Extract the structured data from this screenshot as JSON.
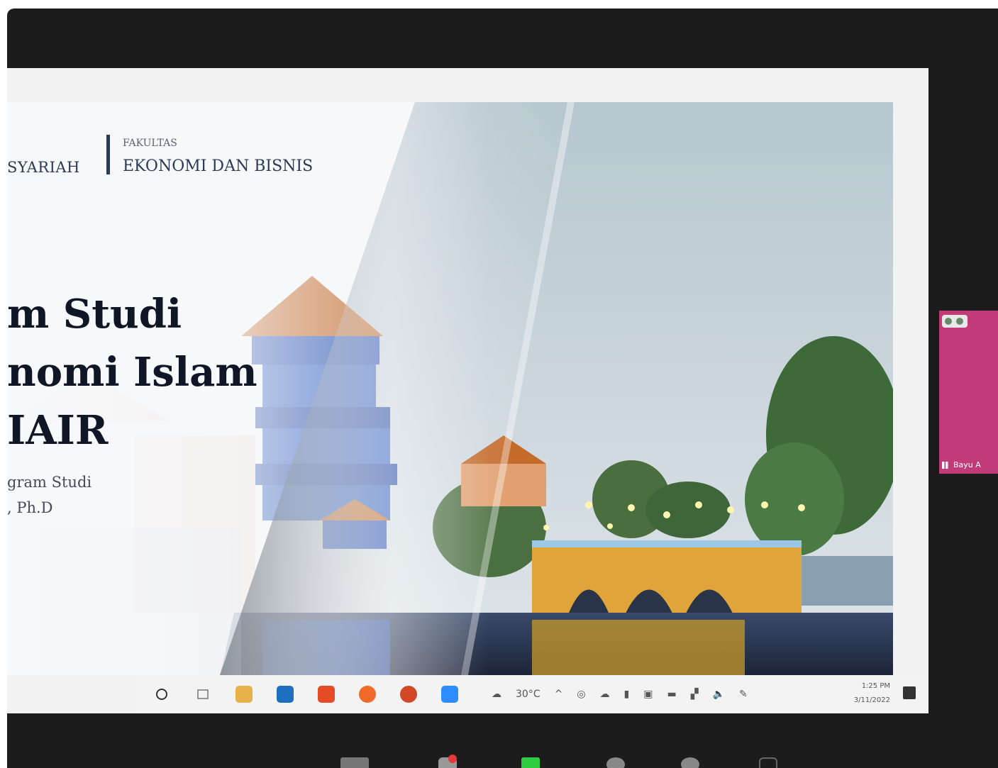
{
  "slide": {
    "header_left": "SYARIAH",
    "faculty_small": "FAKULTAS",
    "faculty_name": "EKONOMI DAN BISNIS",
    "title_lines": [
      "m Studi",
      "nomi Islam",
      "IAIR"
    ],
    "subtitle_lines": [
      "gram Studi",
      ", Ph.D"
    ]
  },
  "taskbar": {
    "weather": "30°C",
    "time": "1:25 PM",
    "date": "3/11/2022",
    "app_colors": {
      "explorer": "#e8b24a",
      "mail": "#1e6fbf",
      "office": "#e34c26",
      "firefox": "#f06a2a",
      "powerpoint": "#d24726",
      "zoom": "#2d8cff"
    }
  },
  "participant": {
    "name": "Bayu A",
    "tile_color": "#c23a78"
  },
  "colors": {
    "bezel": "#1c1c1c",
    "title": "#0f1626",
    "header": "#2b3a55"
  }
}
